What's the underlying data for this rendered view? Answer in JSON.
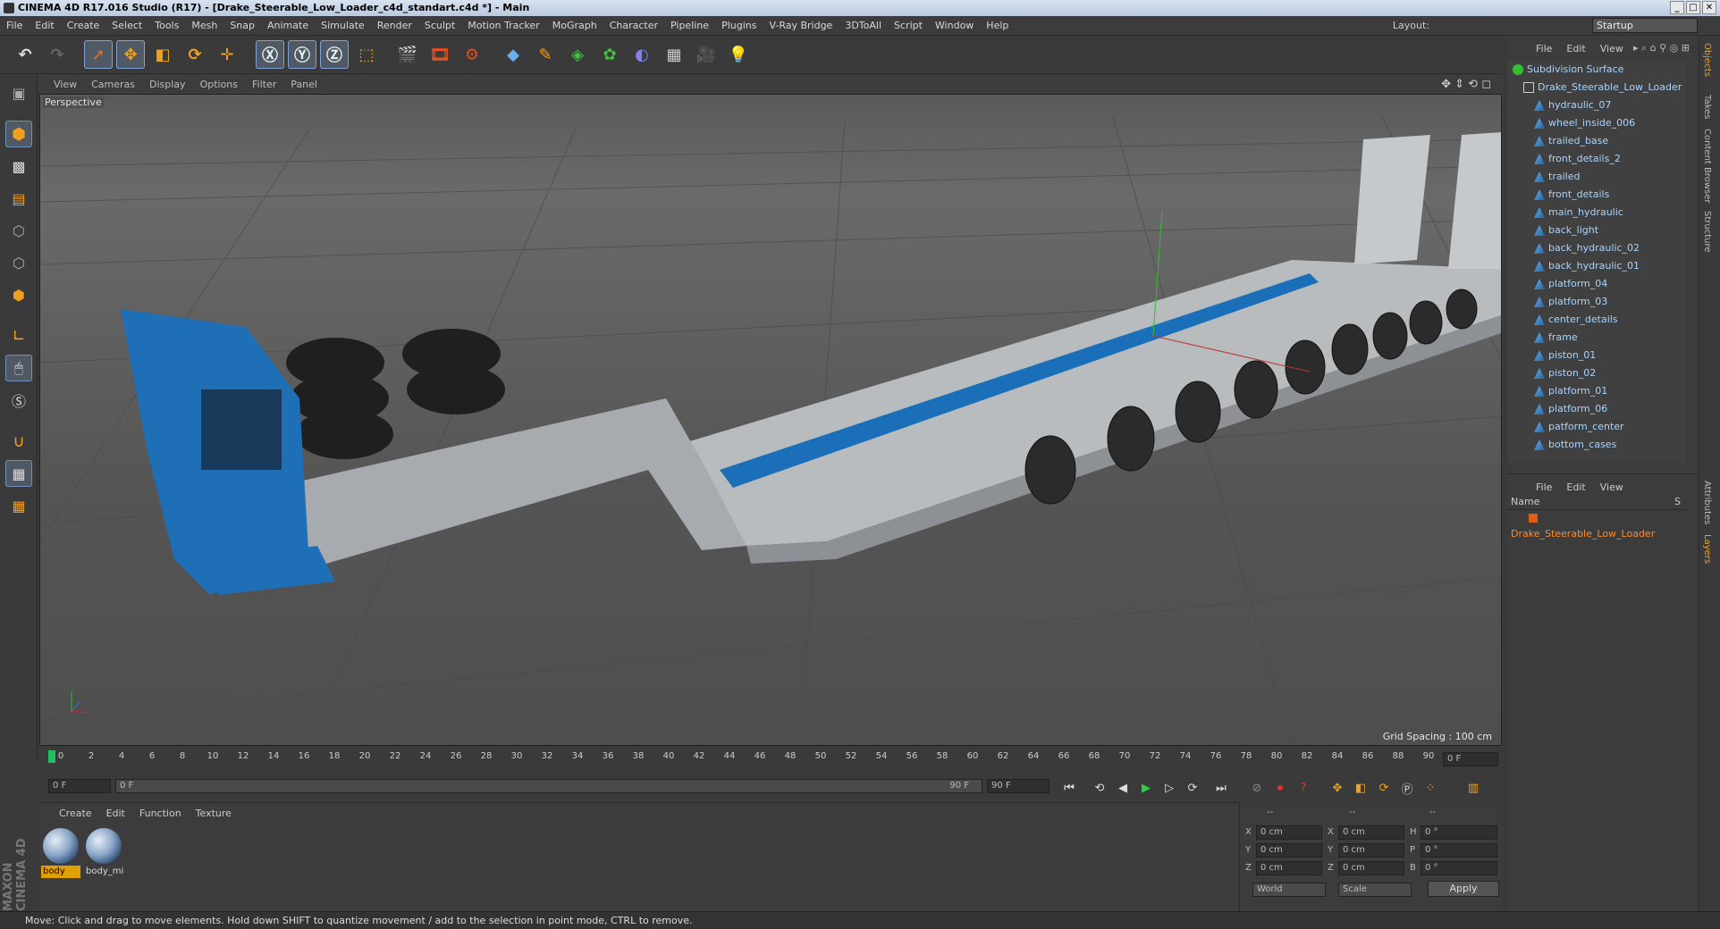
{
  "window": {
    "title": "CINEMA 4D R17.016 Studio (R17) - [Drake_Steerable_Low_Loader_c4d_standart.c4d *] - Main"
  },
  "menu": [
    "File",
    "Edit",
    "Create",
    "Select",
    "Tools",
    "Mesh",
    "Snap",
    "Animate",
    "Simulate",
    "Render",
    "Sculpt",
    "Motion Tracker",
    "MoGraph",
    "Character",
    "Pipeline",
    "Plugins",
    "V-Ray Bridge",
    "3DToAll",
    "Script",
    "Window",
    "Help"
  ],
  "layout": {
    "label": "Layout:",
    "value": "Startup"
  },
  "viewport": {
    "menu": [
      "View",
      "Cameras",
      "Display",
      "Options",
      "Filter",
      "Panel"
    ],
    "camera_label": "Perspective",
    "grid_spacing": "Grid Spacing : 100 cm"
  },
  "timeline": {
    "ticks": [
      "0",
      "2",
      "4",
      "6",
      "8",
      "10",
      "12",
      "14",
      "16",
      "18",
      "20",
      "22",
      "24",
      "26",
      "28",
      "30",
      "32",
      "34",
      "36",
      "38",
      "40",
      "42",
      "44",
      "46",
      "48",
      "50",
      "52",
      "54",
      "56",
      "58",
      "60",
      "62",
      "64",
      "66",
      "68",
      "70",
      "72",
      "74",
      "76",
      "78",
      "80",
      "82",
      "84",
      "86",
      "88",
      "90"
    ],
    "current_frame": "0 F",
    "start_field": "0 F",
    "range_start": "0 F",
    "range_end": "90 F",
    "end_field": "90 F"
  },
  "material_manager": {
    "menu": [
      "Create",
      "Edit",
      "Function",
      "Texture"
    ],
    "materials": [
      {
        "name": "body",
        "selected": true
      },
      {
        "name": "body_mi",
        "selected": false
      }
    ]
  },
  "coordinates": {
    "headers": [
      "--",
      "--",
      "--"
    ],
    "rows": [
      {
        "a": "X",
        "a_val": "0 cm",
        "b": "X",
        "b_val": "0 cm",
        "c": "H",
        "c_val": "0 °"
      },
      {
        "a": "Y",
        "a_val": "0 cm",
        "b": "Y",
        "b_val": "0 cm",
        "c": "P",
        "c_val": "0 °"
      },
      {
        "a": "Z",
        "a_val": "0 cm",
        "b": "Z",
        "b_val": "0 cm",
        "c": "B",
        "c_val": "0 °"
      }
    ],
    "mode": "World",
    "scale": "Scale",
    "apply": "Apply"
  },
  "object_manager": {
    "menu": [
      "File",
      "Edit",
      "View"
    ],
    "objects": [
      {
        "name": "Subdivision Surface",
        "level": 0
      },
      {
        "name": "Drake_Steerable_Low_Loader",
        "level": 1
      },
      {
        "name": "hydraulic_07",
        "level": 2
      },
      {
        "name": "wheel_inside_006",
        "level": 2
      },
      {
        "name": "trailed_base",
        "level": 2
      },
      {
        "name": "front_details_2",
        "level": 2
      },
      {
        "name": "trailed",
        "level": 2
      },
      {
        "name": "front_details",
        "level": 2
      },
      {
        "name": "main_hydraulic",
        "level": 2
      },
      {
        "name": "back_light",
        "level": 2
      },
      {
        "name": "back_hydraulic_02",
        "level": 2
      },
      {
        "name": "back_hydraulic_01",
        "level": 2
      },
      {
        "name": "platform_04",
        "level": 2
      },
      {
        "name": "platform_03",
        "level": 2
      },
      {
        "name": "center_details",
        "level": 2
      },
      {
        "name": "frame",
        "level": 2
      },
      {
        "name": "piston_01",
        "level": 2
      },
      {
        "name": "piston_02",
        "level": 2
      },
      {
        "name": "platform_01",
        "level": 2
      },
      {
        "name": "platform_06",
        "level": 2
      },
      {
        "name": "patform_center",
        "level": 2
      },
      {
        "name": "bottom_cases",
        "level": 2
      }
    ]
  },
  "layer_manager": {
    "menu": [
      "File",
      "Edit",
      "View"
    ],
    "column_name": "Name",
    "column_s": "S",
    "layer": "Drake_Steerable_Low_Loader"
  },
  "right_tabs": [
    "Objects",
    "Takes",
    "Content Browser",
    "Structure",
    "Attributes",
    "Layers"
  ],
  "status": "Move: Click and drag to move elements. Hold down SHIFT to quantize movement / add to the selection in point mode, CTRL to remove.",
  "brand": "MAXON CINEMA 4D",
  "colors": {
    "accent": "#1a78c8",
    "selected_material": "#e0a000",
    "object_text": "#a6d4ff",
    "layer_text": "#ff8a2a"
  }
}
